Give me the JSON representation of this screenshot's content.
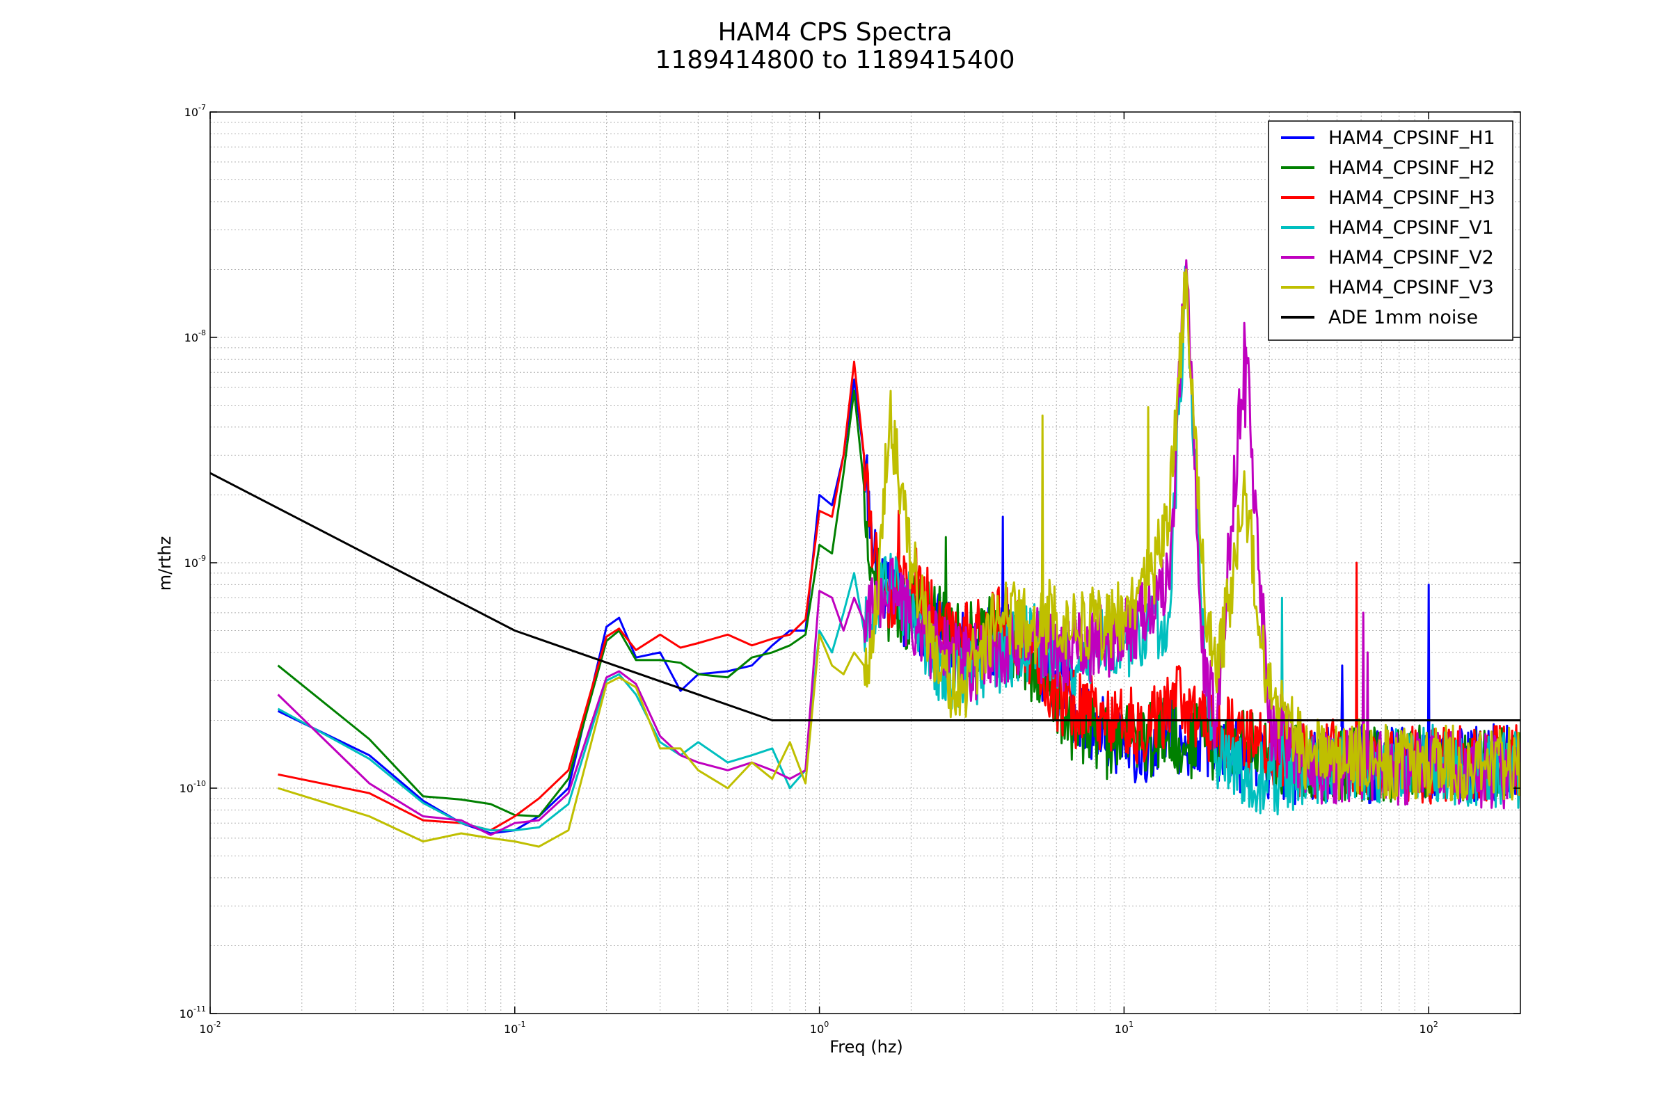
{
  "chart_data": {
    "type": "line",
    "title": "HAM4 CPS Spectra",
    "subtitle": "1189414800 to 1189415400",
    "xlabel": "Freq (hz)",
    "ylabel": "m/rthz",
    "xscale": "log",
    "yscale": "log",
    "xlim": [
      0.01,
      200
    ],
    "ylim": [
      1e-11,
      1e-07
    ],
    "grid": true,
    "legend_position": "top-right",
    "x_ticks": [
      {
        "base": "10",
        "exp": "-2",
        "value": 0.01
      },
      {
        "base": "10",
        "exp": "-1",
        "value": 0.1
      },
      {
        "base": "10",
        "exp": "0",
        "value": 1
      },
      {
        "base": "10",
        "exp": "1",
        "value": 10
      },
      {
        "base": "10",
        "exp": "2",
        "value": 100
      }
    ],
    "y_ticks": [
      {
        "base": "10",
        "exp": "-11",
        "value": 1e-11
      },
      {
        "base": "10",
        "exp": "-10",
        "value": 1e-10
      },
      {
        "base": "10",
        "exp": "-9",
        "value": 1e-09
      },
      {
        "base": "10",
        "exp": "-8",
        "value": 1e-08
      },
      {
        "base": "10",
        "exp": "-7",
        "value": 1e-07
      }
    ],
    "series": [
      {
        "name": "HAM4_CPSINF_H1",
        "color": "#0000ff",
        "x": [
          0.0167,
          0.0333,
          0.05,
          0.0667,
          0.0833,
          0.1,
          0.12,
          0.15,
          0.2,
          0.22,
          0.25,
          0.3,
          0.35,
          0.4,
          0.5,
          0.6,
          0.7,
          0.8,
          0.9,
          1.0,
          1.1,
          1.2,
          1.3,
          1.4,
          1.5,
          1.7,
          2.0,
          2.5,
          3,
          4,
          5,
          6,
          7,
          8,
          9,
          10,
          12,
          14,
          16,
          18,
          20,
          25,
          30,
          40,
          50,
          60,
          70,
          80,
          100,
          150,
          200
        ],
        "y": [
          2.2e-10,
          1.4e-10,
          8.8e-11,
          7e-11,
          6.3e-11,
          6.5e-11,
          7.5e-11,
          1e-10,
          5.2e-10,
          5.7e-10,
          3.8e-10,
          4e-10,
          2.7e-10,
          3.2e-10,
          3.3e-10,
          3.5e-10,
          4.3e-10,
          5e-10,
          5e-10,
          2e-09,
          1.8e-09,
          3e-09,
          6.5e-09,
          3e-09,
          1e-09,
          7e-10,
          6e-10,
          5e-10,
          4e-10,
          4.5e-10,
          4e-10,
          3e-10,
          2.2e-10,
          1.8e-10,
          1.7e-10,
          1.6e-10,
          1.5e-10,
          2e-10,
          1.4e-10,
          1.8e-10,
          1.5e-10,
          1.4e-10,
          1.3e-10,
          1.2e-10,
          1.3e-10,
          1.3e-10,
          1.2e-10,
          1.3e-10,
          1.25e-10,
          1.3e-10,
          1.3e-10
        ],
        "peaks": [
          {
            "x": 4.0,
            "y": 1.6e-09
          },
          {
            "x": 52,
            "y": 3.5e-10
          },
          {
            "x": 100,
            "y": 8e-10
          }
        ]
      },
      {
        "name": "HAM4_CPSINF_H2",
        "color": "#008000",
        "x": [
          0.0167,
          0.0333,
          0.05,
          0.0667,
          0.0833,
          0.1,
          0.12,
          0.15,
          0.2,
          0.22,
          0.25,
          0.3,
          0.35,
          0.4,
          0.5,
          0.6,
          0.7,
          0.8,
          0.9,
          1.0,
          1.1,
          1.2,
          1.3,
          1.4,
          1.5,
          1.7,
          2.0,
          2.5,
          3,
          4,
          5,
          6,
          7,
          8,
          9,
          10,
          12,
          14,
          16,
          18,
          20,
          25,
          30,
          40,
          50,
          60,
          70,
          80,
          100,
          150,
          200
        ],
        "y": [
          3.5e-10,
          1.65e-10,
          9.2e-11,
          8.9e-11,
          8.5e-11,
          7.6e-11,
          7.5e-11,
          1.1e-10,
          4.5e-10,
          5e-10,
          3.7e-10,
          3.7e-10,
          3.6e-10,
          3.2e-10,
          3.1e-10,
          3.8e-10,
          4e-10,
          4.3e-10,
          4.8e-10,
          1.2e-09,
          1.1e-09,
          2.5e-09,
          5.8e-09,
          2.2e-09,
          9e-10,
          6.5e-10,
          6e-10,
          5.5e-10,
          4.5e-10,
          5e-10,
          3.5e-10,
          2.6e-10,
          1.7e-10,
          1.7e-10,
          1.6e-10,
          1.7e-10,
          1.6e-10,
          1.8e-10,
          1.5e-10,
          1.7e-10,
          1.5e-10,
          1.5e-10,
          1.4e-10,
          1.3e-10,
          1.3e-10,
          1.3e-10,
          1.3e-10,
          1.25e-10,
          1.3e-10,
          1.3e-10,
          1.3e-10
        ],
        "peaks": [
          {
            "x": 2.6,
            "y": 1.3e-09
          }
        ]
      },
      {
        "name": "HAM4_CPSINF_H3",
        "color": "#ff0000",
        "x": [
          0.0167,
          0.0333,
          0.05,
          0.0667,
          0.0833,
          0.1,
          0.12,
          0.15,
          0.2,
          0.22,
          0.25,
          0.3,
          0.35,
          0.4,
          0.5,
          0.6,
          0.7,
          0.8,
          0.9,
          1.0,
          1.1,
          1.2,
          1.3,
          1.4,
          1.5,
          1.7,
          2.0,
          2.5,
          3,
          4,
          5,
          6,
          7,
          8,
          9,
          10,
          12,
          14,
          16,
          18,
          20,
          25,
          30,
          40,
          50,
          60,
          70,
          80,
          100,
          150,
          200
        ],
        "y": [
          1.15e-10,
          9.5e-11,
          7.2e-11,
          7e-11,
          6.5e-11,
          7.5e-11,
          9e-11,
          1.2e-10,
          4.7e-10,
          5.1e-10,
          4.1e-10,
          4.8e-10,
          4.2e-10,
          4.4e-10,
          4.8e-10,
          4.3e-10,
          4.6e-10,
          4.8e-10,
          5.6e-10,
          1.7e-09,
          1.6e-09,
          3e-09,
          7.8e-09,
          3e-09,
          1e-09,
          7e-10,
          9e-10,
          5e-10,
          4.5e-10,
          5.5e-10,
          4e-10,
          2.6e-10,
          2.2e-10,
          2.3e-10,
          2e-10,
          2e-10,
          1.8e-10,
          2.3e-10,
          2.4e-10,
          2e-10,
          1.9e-10,
          1.6e-10,
          1.5e-10,
          1.3e-10,
          1.4e-10,
          1.3e-10,
          1.25e-10,
          1.3e-10,
          1.25e-10,
          1.3e-10,
          1.3e-10
        ],
        "peaks": [
          {
            "x": 1.82,
            "y": 1.7e-09
          },
          {
            "x": 58,
            "y": 1e-09
          }
        ]
      },
      {
        "name": "HAM4_CPSINF_V1",
        "color": "#00bfbf",
        "x": [
          0.0167,
          0.0333,
          0.05,
          0.0667,
          0.0833,
          0.1,
          0.12,
          0.15,
          0.2,
          0.22,
          0.25,
          0.3,
          0.35,
          0.4,
          0.5,
          0.6,
          0.7,
          0.8,
          0.9,
          1.0,
          1.1,
          1.2,
          1.3,
          1.4,
          1.5,
          1.7,
          2.0,
          2.5,
          3,
          4,
          5,
          6,
          7,
          8,
          9,
          10,
          12,
          14,
          16,
          18,
          20,
          25,
          30,
          40,
          50,
          60,
          70,
          80,
          100,
          150,
          200
        ],
        "y": [
          2.25e-10,
          1.35e-10,
          8.6e-11,
          7e-11,
          6.5e-11,
          6.5e-11,
          6.7e-11,
          8.5e-11,
          3e-10,
          3.2e-10,
          2.6e-10,
          1.6e-10,
          1.4e-10,
          1.6e-10,
          1.3e-10,
          1.4e-10,
          1.5e-10,
          1e-10,
          1.2e-10,
          5e-10,
          4e-10,
          6e-10,
          9e-10,
          5e-10,
          6e-10,
          8e-10,
          6e-10,
          3.5e-10,
          3e-10,
          4e-10,
          4.5e-10,
          4e-10,
          3.5e-10,
          4e-10,
          4.5e-10,
          4.5e-10,
          5e-10,
          6e-10,
          2e-08,
          5e-10,
          1.5e-10,
          1.2e-10,
          1.1e-10,
          1.2e-10,
          1.2e-10,
          1.3e-10,
          1.2e-10,
          1.25e-10,
          1.3e-10,
          1.2e-10,
          1.2e-10
        ],
        "peaks": [
          {
            "x": 22,
            "y": 1e-10
          },
          {
            "x": 33,
            "y": 7e-10
          }
        ]
      },
      {
        "name": "HAM4_CPSINF_V2",
        "color": "#bf00bf",
        "x": [
          0.0167,
          0.0333,
          0.05,
          0.0667,
          0.0833,
          0.1,
          0.12,
          0.15,
          0.2,
          0.22,
          0.25,
          0.3,
          0.35,
          0.4,
          0.5,
          0.6,
          0.7,
          0.8,
          0.9,
          1.0,
          1.1,
          1.2,
          1.3,
          1.4,
          1.5,
          1.7,
          2.0,
          2.5,
          3,
          4,
          5,
          6,
          7,
          8,
          9,
          10,
          12,
          14,
          16,
          18,
          20,
          25,
          30,
          40,
          50,
          60,
          70,
          80,
          100,
          150,
          200
        ],
        "y": [
          2.6e-10,
          1.05e-10,
          7.5e-11,
          7.2e-11,
          6.2e-11,
          7e-11,
          7.2e-11,
          9.5e-11,
          3.1e-10,
          3.3e-10,
          2.9e-10,
          1.7e-10,
          1.4e-10,
          1.3e-10,
          1.2e-10,
          1.3e-10,
          1.2e-10,
          1.1e-10,
          1.2e-10,
          7.5e-10,
          7e-10,
          5e-10,
          7e-10,
          5.5e-10,
          6e-10,
          7.5e-10,
          5.5e-10,
          4e-10,
          3.5e-10,
          4e-10,
          4.5e-10,
          4e-10,
          4e-10,
          4.5e-10,
          4.5e-10,
          5e-10,
          6e-10,
          8e-10,
          2.2e-08,
          4e-10,
          2e-10,
          9e-09,
          2e-10,
          1.3e-10,
          1.2e-10,
          1.3e-10,
          1.2e-10,
          1.2e-10,
          1.3e-10,
          1.2e-10,
          1.2e-10
        ],
        "peaks": [
          {
            "x": 25,
            "y": 4e-09
          },
          {
            "x": 61,
            "y": 6e-10
          },
          {
            "x": 63,
            "y": 4e-10
          }
        ]
      },
      {
        "name": "HAM4_CPSINF_V3",
        "color": "#bfbf00",
        "x": [
          0.0167,
          0.0333,
          0.05,
          0.0667,
          0.0833,
          0.1,
          0.12,
          0.15,
          0.2,
          0.22,
          0.25,
          0.3,
          0.35,
          0.4,
          0.5,
          0.6,
          0.7,
          0.8,
          0.9,
          1.0,
          1.1,
          1.2,
          1.3,
          1.4,
          1.5,
          1.7,
          2.0,
          2.5,
          3,
          4,
          5,
          6,
          7,
          8,
          9,
          10,
          12,
          14,
          16,
          18,
          20,
          25,
          30,
          40,
          50,
          60,
          70,
          80,
          100,
          150,
          200
        ],
        "y": [
          1e-10,
          7.5e-11,
          5.8e-11,
          6.3e-11,
          6e-11,
          5.8e-11,
          5.5e-11,
          6.5e-11,
          2.9e-10,
          3.1e-10,
          2.8e-10,
          1.5e-10,
          1.5e-10,
          1.2e-10,
          1e-10,
          1.3e-10,
          1.1e-10,
          1.6e-10,
          1.05e-10,
          4.8e-10,
          3.5e-10,
          3.2e-10,
          4e-10,
          3.5e-10,
          4e-10,
          4.4e-09,
          1e-09,
          3e-10,
          3e-10,
          6e-10,
          5e-10,
          6e-10,
          5e-10,
          5.5e-10,
          5e-10,
          6e-10,
          8e-10,
          1.5e-09,
          2e-08,
          1e-09,
          3e-10,
          2e-09,
          2.5e-10,
          1.4e-10,
          1.3e-10,
          1.4e-10,
          1.3e-10,
          1.3e-10,
          1.3e-10,
          1.3e-10,
          1.3e-10
        ],
        "peaks": [
          {
            "x": 5.4,
            "y": 4.5e-09
          },
          {
            "x": 12,
            "y": 4.9e-09
          }
        ]
      },
      {
        "name": "ADE 1mm noise",
        "color": "#000000",
        "x": [
          0.01,
          0.1,
          0.7,
          200
        ],
        "y": [
          2.5e-09,
          5e-10,
          2e-10,
          2e-10
        ]
      }
    ]
  }
}
